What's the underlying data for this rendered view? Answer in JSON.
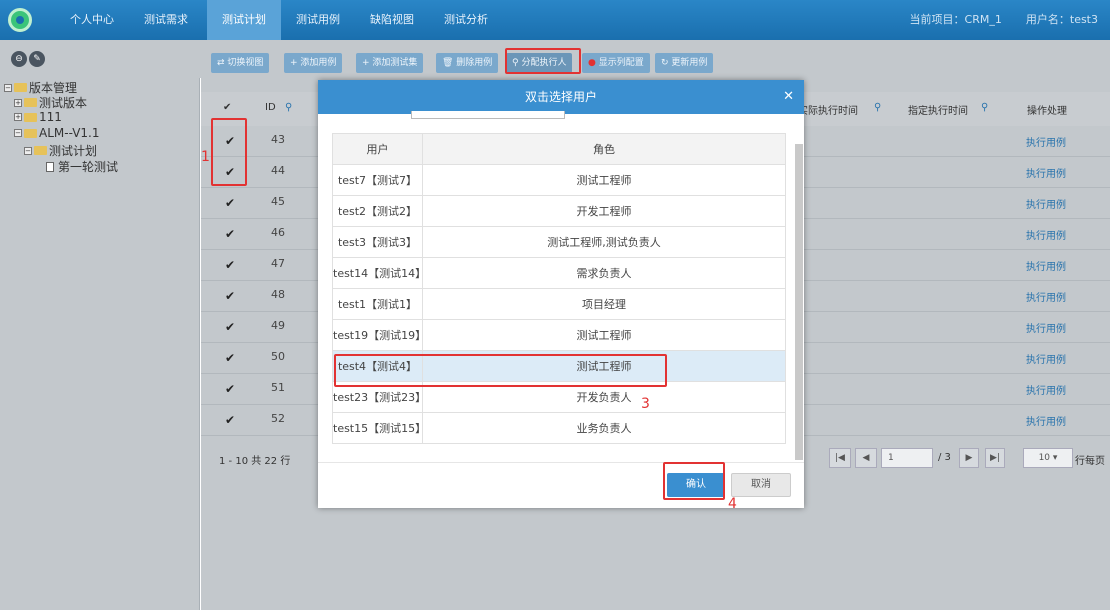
{
  "nav": {
    "items": [
      "个人中心",
      "测试需求",
      "测试计划",
      "测试用例",
      "缺陷视图",
      "测试分析"
    ],
    "active_index": 2,
    "project": "当前项目：CRM_1",
    "user": "用户名：test3"
  },
  "toolbar": {
    "buttons": [
      "⇄ 切换视图",
      "+ 添加用例",
      "+ 添加测试集",
      "🗑 删除用例",
      "⚲ 分配执行人",
      "显示列配置",
      "↻ 更新用例"
    ]
  },
  "tree": {
    "root": "版本管理",
    "n1": "测试版本",
    "n2": "111",
    "n3": "ALM--V1.1",
    "n4": "测试计划",
    "n5": "第一轮测试"
  },
  "grid": {
    "headers": {
      "check": "✔",
      "id": "ID",
      "actual_time": "实际执行时间",
      "plan_time": "指定执行时间",
      "ops": "操作处理"
    },
    "rows": [
      {
        "id": "43",
        "action": "执行用例"
      },
      {
        "id": "44",
        "action": "执行用例"
      },
      {
        "id": "45",
        "action": "执行用例"
      },
      {
        "id": "46",
        "action": "执行用例"
      },
      {
        "id": "47",
        "action": "执行用例"
      },
      {
        "id": "48",
        "action": "执行用例"
      },
      {
        "id": "49",
        "action": "执行用例"
      },
      {
        "id": "50",
        "action": "执行用例"
      },
      {
        "id": "51",
        "action": "执行用例"
      },
      {
        "id": "52",
        "action": "执行用例"
      }
    ],
    "summary": "1 - 10 共 22 行",
    "page": "1",
    "page_total": "/ 3",
    "page_size": "10",
    "per_page_label": "行每页"
  },
  "modal": {
    "title": "双击选择用户",
    "col_user": "用户",
    "col_role": "角色",
    "users": [
      {
        "user": "test7【测试7】",
        "role": "测试工程师"
      },
      {
        "user": "test2【测试2】",
        "role": "开发工程师"
      },
      {
        "user": "test3【测试3】",
        "role": "测试工程师,测试负责人"
      },
      {
        "user": "test14【测试14】",
        "role": "需求负责人"
      },
      {
        "user": "test1【测试1】",
        "role": "项目经理"
      },
      {
        "user": "test19【测试19】",
        "role": "测试工程师"
      },
      {
        "user": "test4【测试4】",
        "role": "测试工程师"
      },
      {
        "user": "test23【测试23】",
        "role": "开发负责人"
      },
      {
        "user": "test15【测试15】",
        "role": "业务负责人"
      }
    ],
    "ok": "确认",
    "cancel": "取消"
  },
  "annotations": {
    "a1": "1",
    "a3": "3",
    "a4": "4"
  },
  "colors": {
    "nav": "#1e7bbd",
    "accent": "#3a8fd0",
    "annotation": "#e23232"
  }
}
